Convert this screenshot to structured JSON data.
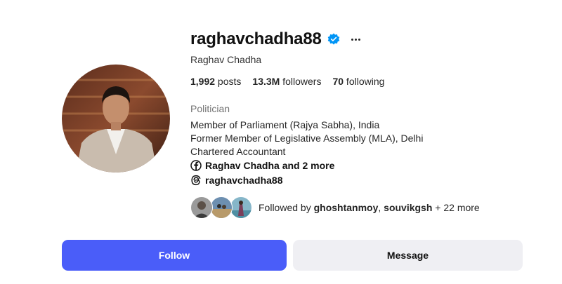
{
  "profile": {
    "username": "raghavchadha88",
    "full_name": "Raghav Chadha",
    "stats": {
      "posts_count": "1,992",
      "posts_label": " posts",
      "followers_count": "13.3M",
      "followers_label": " followers",
      "following_count": "70",
      "following_label": " following"
    },
    "category": "Politician",
    "bio_lines": [
      "Member of Parliament (Rajya Sabha), India",
      "Former Member of Legislative Assembly (MLA), Delhi",
      "Chartered Accountant"
    ],
    "facebook_link": "Raghav Chadha and 2 more",
    "threads_link": "raghavchadha88",
    "followed_by": {
      "prefix": "Followed by ",
      "user1": "ghoshtanmoy",
      "separator": ", ",
      "user2": "souvikgsh",
      "suffix": " + 22 more"
    }
  },
  "actions": {
    "follow_label": "Follow",
    "message_label": "Message"
  },
  "colors": {
    "follow_button": "#4a5df9",
    "message_button": "#efeff3",
    "verified_badge": "#0095f6"
  },
  "icons": {
    "verified": "verified-badge-icon",
    "more": "more-options-icon",
    "facebook": "facebook-icon",
    "threads": "threads-icon"
  }
}
